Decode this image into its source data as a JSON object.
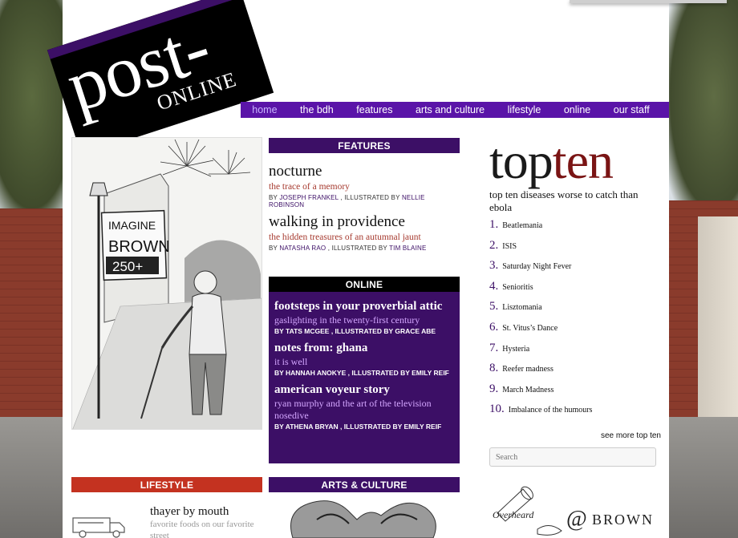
{
  "logo": {
    "post": "post-",
    "online": "ONLINE"
  },
  "nav": {
    "items": [
      {
        "label": "home",
        "active": true
      },
      {
        "label": "the bdh",
        "active": false
      },
      {
        "label": "features",
        "active": false
      },
      {
        "label": "arts and culture",
        "active": false
      },
      {
        "label": "lifestyle",
        "active": false
      },
      {
        "label": "online",
        "active": false
      },
      {
        "label": "our staff",
        "active": false
      }
    ]
  },
  "cartoon": {
    "sign_line1": "IMAGINE",
    "sign_line2": "BROWN",
    "sign_line3": "250+"
  },
  "features": {
    "heading": "FEATURES",
    "stories": [
      {
        "title": "nocturne",
        "subtitle": "the trace of a memory",
        "by": "BY",
        "author": "JOSEPH FRANKEL",
        "illus": ", ILLUSTRATED BY",
        "illustrator": "NELLIE ROBINSON"
      },
      {
        "title": "walking in providence",
        "subtitle": "the hidden treasures of an autumnal jaunt",
        "by": "BY",
        "author": "NATASHA RAO",
        "illus": ", ILLUSTRATED BY",
        "illustrator": "TIM BLAINE"
      }
    ]
  },
  "online": {
    "heading": "ONLINE",
    "stories": [
      {
        "title": "footsteps in your proverbial attic",
        "subtitle": "gaslighting in the twenty-first century",
        "byline": "BY TATS MCGEE , ILLUSTRATED BY GRACE ABE"
      },
      {
        "title": "notes from: ghana",
        "subtitle": "it is well",
        "byline": "BY HANNAH ANOKYE , ILLUSTRATED BY EMILY REIF"
      },
      {
        "title": "american voyeur story",
        "subtitle": "ryan murphy and the art of the television nosedive",
        "byline": "BY ATHENA BRYAN , ILLUSTRATED BY EMILY REIF"
      }
    ]
  },
  "topten": {
    "logo_a": "top",
    "logo_b": "ten",
    "heading": "top ten diseases worse to catch than ebola",
    "items": [
      {
        "num": "1.",
        "text": "Beatlemania"
      },
      {
        "num": "2.",
        "text": "ISIS"
      },
      {
        "num": "3.",
        "text": "Saturday Night Fever"
      },
      {
        "num": "4.",
        "text": "Senioritis"
      },
      {
        "num": "5.",
        "text": "Lisztomania"
      },
      {
        "num": "6.",
        "text": "St. Vitus’s Dance"
      },
      {
        "num": "7.",
        "text": "Hysteria"
      },
      {
        "num": "8.",
        "text": "Reefer madness"
      },
      {
        "num": "9.",
        "text": "March Madness"
      },
      {
        "num": "10.",
        "text": "Imbalance of the humours"
      }
    ],
    "see_more": "see more top ten"
  },
  "search": {
    "placeholder": "Search"
  },
  "lifestyle": {
    "heading": "LIFESTYLE",
    "story_title": "thayer by mouth",
    "story_subtitle": "favorite foods on our favorite street"
  },
  "arts": {
    "heading": "ARTS & CULTURE"
  },
  "overheard": {
    "text_a": "Overheard",
    "at": "@",
    "text_b": "BROWN"
  },
  "colors": {
    "brand_purple": "#3c0f66",
    "nav_purple": "#5a14a8",
    "lifestyle_red": "#c43220",
    "subtitle_red": "#a63a2f"
  }
}
